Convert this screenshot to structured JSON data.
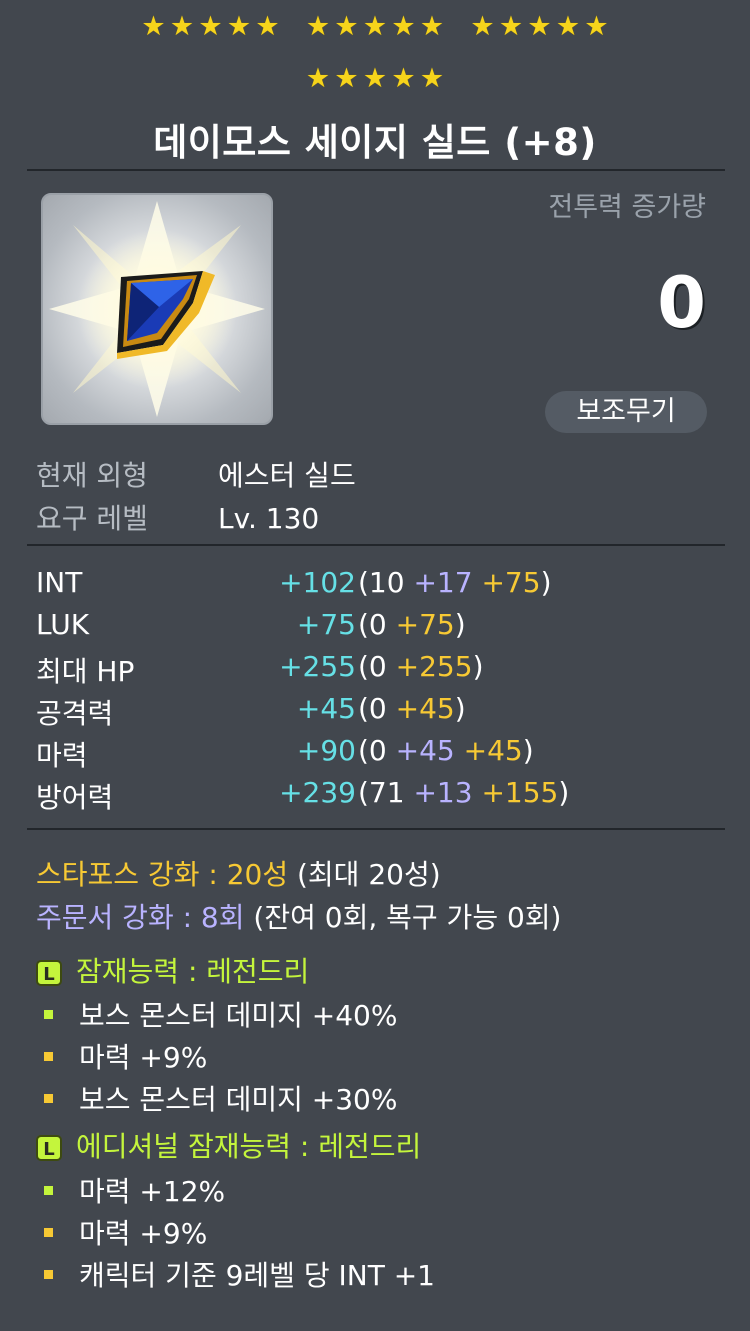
{
  "header": {
    "star_glyph": "★",
    "star_groups": [
      5,
      5,
      5,
      5
    ],
    "star_color": "#f6d41b",
    "title": "데이모스 세이지 실드 (+8)"
  },
  "item": {
    "icon": "deimos-sage-shield-icon",
    "cp_label": "전투력 증가량",
    "cp_value": "0",
    "type_badge": "보조무기",
    "info": [
      {
        "key": "현재 외형",
        "value": "에스터 실드"
      },
      {
        "key": "요구 레벨",
        "value": "Lv. 130"
      }
    ]
  },
  "stats": [
    {
      "name": "INT",
      "total": "+102",
      "open": "(10",
      "parts": [
        {
          "text": "+17",
          "color": "purple"
        },
        {
          "text": "+75",
          "color": "yellow"
        }
      ],
      "close": ")"
    },
    {
      "name": "LUK",
      "total": "+75",
      "open": "(0",
      "parts": [
        {
          "text": "+75",
          "color": "yellow"
        }
      ],
      "close": ")"
    },
    {
      "name": "최대 HP",
      "total": "+255",
      "open": "(0",
      "parts": [
        {
          "text": "+255",
          "color": "yellow"
        }
      ],
      "close": ")"
    },
    {
      "name": "공격력",
      "total": "+45",
      "open": "(0",
      "parts": [
        {
          "text": "+45",
          "color": "yellow"
        }
      ],
      "close": ")"
    },
    {
      "name": "마력",
      "total": "+90",
      "open": "(0",
      "parts": [
        {
          "text": "+45",
          "color": "purple"
        },
        {
          "text": "+45",
          "color": "yellow"
        }
      ],
      "close": ")"
    },
    {
      "name": "방어력",
      "total": "+239",
      "open": "(71",
      "parts": [
        {
          "text": "+13",
          "color": "purple"
        },
        {
          "text": "+155",
          "color": "yellow"
        }
      ],
      "close": ")"
    }
  ],
  "enhance": {
    "starforce_label": "스타포스 강화 : 20성",
    "starforce_note": " (최대 20성)",
    "scroll_label": "주문서 강화 : 8회",
    "scroll_note": " (잔여 0회, 복구 가능 0회)"
  },
  "potential": {
    "grade_letter": "L",
    "title": "잠재능력 : 레전드리",
    "options": [
      {
        "text": "보스 몬스터 데미지 +40%",
        "bullet": "green"
      },
      {
        "text": "마력 +9%",
        "bullet": "yellow"
      },
      {
        "text": "보스 몬스터 데미지 +30%",
        "bullet": "yellow"
      }
    ]
  },
  "additional": {
    "grade_letter": "L",
    "title": "에디셔널 잠재능력 : 레전드리",
    "options": [
      {
        "text": "마력 +12%",
        "bullet": "green"
      },
      {
        "text": "마력 +9%",
        "bullet": "yellow"
      },
      {
        "text": "캐릭터 기준 9레벨 당 INT +1",
        "bullet": "yellow"
      }
    ]
  },
  "colors": {
    "background": "#42474e",
    "stat_total": "#66e0e6",
    "scroll_bonus": "#b9b3ff",
    "starforce_bonus": "#f7c934",
    "legendary": "#c4f53c"
  }
}
